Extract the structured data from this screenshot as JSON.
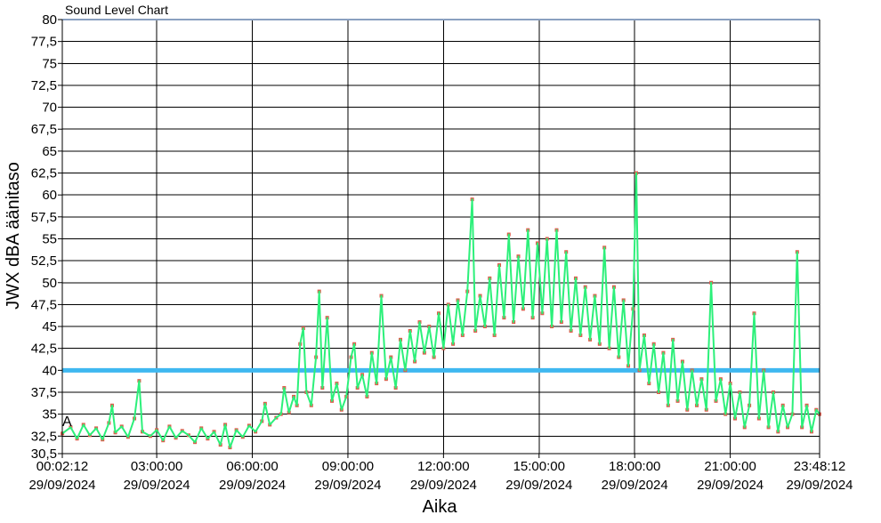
{
  "chart_data": {
    "type": "line",
    "title": "Sound Level Chart",
    "xlabel": "Aika",
    "ylabel": "JWX dBA äänitaso",
    "ylim": [
      30.5,
      80
    ],
    "xlim": [
      "00:02:12",
      "23:48:12"
    ],
    "grid": true,
    "yticks": [
      "30,5",
      "32,5",
      "35",
      "37,5",
      "40",
      "42,5",
      "45",
      "47,5",
      "50",
      "52,5",
      "55",
      "57,5",
      "60",
      "62,5",
      "65",
      "67,5",
      "70",
      "72,5",
      "75",
      "77,5",
      "80"
    ],
    "ytick_values": [
      30.5,
      32.5,
      35,
      37.5,
      40,
      42.5,
      45,
      47.5,
      50,
      52.5,
      55,
      57.5,
      60,
      62.5,
      65,
      67.5,
      70,
      72.5,
      75,
      77.5,
      80
    ],
    "xticks": [
      {
        "time": "00:02:12",
        "date": "29/09/2024",
        "hour": 0.0367
      },
      {
        "time": "03:00:00",
        "date": "29/09/2024",
        "hour": 3
      },
      {
        "time": "06:00:00",
        "date": "29/09/2024",
        "hour": 6
      },
      {
        "time": "09:00:00",
        "date": "29/09/2024",
        "hour": 9
      },
      {
        "time": "12:00:00",
        "date": "29/09/2024",
        "hour": 12
      },
      {
        "time": "15:00:00",
        "date": "29/09/2024",
        "hour": 15
      },
      {
        "time": "18:00:00",
        "date": "29/09/2024",
        "hour": 18
      },
      {
        "time": "21:00:00",
        "date": "29/09/2024",
        "hour": 21
      },
      {
        "time": "23:48:12",
        "date": "29/09/2024",
        "hour": 23.8033
      }
    ],
    "threshold": {
      "value": 40,
      "color": "#3FB8F0"
    },
    "marker_label": "A",
    "series": [
      {
        "color": "#2CF07A",
        "marker_color": "#E05A4A",
        "points": [
          [
            0.04,
            32.8
          ],
          [
            0.3,
            33.5
          ],
          [
            0.5,
            32.2
          ],
          [
            0.7,
            33.8
          ],
          [
            0.9,
            32.6
          ],
          [
            1.1,
            33.4
          ],
          [
            1.3,
            32.1
          ],
          [
            1.5,
            34.0
          ],
          [
            1.6,
            36.0
          ],
          [
            1.7,
            32.9
          ],
          [
            1.9,
            33.6
          ],
          [
            2.1,
            32.4
          ],
          [
            2.3,
            34.5
          ],
          [
            2.45,
            38.8
          ],
          [
            2.55,
            33.0
          ],
          [
            2.8,
            32.5
          ],
          [
            3.0,
            33.2
          ],
          [
            3.2,
            32.0
          ],
          [
            3.4,
            33.6
          ],
          [
            3.6,
            32.3
          ],
          [
            3.8,
            33.1
          ],
          [
            4.0,
            32.6
          ],
          [
            4.2,
            31.8
          ],
          [
            4.4,
            33.4
          ],
          [
            4.6,
            32.2
          ],
          [
            4.8,
            33.0
          ],
          [
            5.0,
            31.5
          ],
          [
            5.15,
            33.8
          ],
          [
            5.3,
            31.2
          ],
          [
            5.5,
            33.2
          ],
          [
            5.7,
            32.4
          ],
          [
            5.9,
            33.7
          ],
          [
            6.1,
            33.0
          ],
          [
            6.3,
            34.2
          ],
          [
            6.4,
            36.2
          ],
          [
            6.55,
            33.8
          ],
          [
            6.75,
            34.6
          ],
          [
            6.9,
            35.0
          ],
          [
            7.0,
            38.0
          ],
          [
            7.15,
            35.2
          ],
          [
            7.3,
            37.0
          ],
          [
            7.4,
            36.0
          ],
          [
            7.5,
            43.0
          ],
          [
            7.6,
            44.8
          ],
          [
            7.7,
            37.5
          ],
          [
            7.85,
            36.0
          ],
          [
            8.0,
            41.5
          ],
          [
            8.1,
            49.0
          ],
          [
            8.2,
            38.0
          ],
          [
            8.35,
            46.0
          ],
          [
            8.5,
            36.5
          ],
          [
            8.65,
            38.5
          ],
          [
            8.8,
            35.5
          ],
          [
            8.95,
            37.0
          ],
          [
            9.1,
            41.5
          ],
          [
            9.2,
            43.0
          ],
          [
            9.3,
            38.0
          ],
          [
            9.45,
            39.5
          ],
          [
            9.6,
            37.0
          ],
          [
            9.75,
            42.0
          ],
          [
            9.9,
            38.5
          ],
          [
            10.05,
            48.5
          ],
          [
            10.2,
            39.0
          ],
          [
            10.35,
            41.5
          ],
          [
            10.5,
            38.0
          ],
          [
            10.65,
            43.5
          ],
          [
            10.8,
            40.0
          ],
          [
            10.95,
            44.5
          ],
          [
            11.1,
            41.0
          ],
          [
            11.25,
            45.5
          ],
          [
            11.4,
            42.0
          ],
          [
            11.55,
            45.0
          ],
          [
            11.7,
            41.5
          ],
          [
            11.85,
            46.5
          ],
          [
            12.0,
            42.5
          ],
          [
            12.15,
            47.5
          ],
          [
            12.3,
            43.0
          ],
          [
            12.45,
            48.0
          ],
          [
            12.6,
            44.0
          ],
          [
            12.75,
            49.0
          ],
          [
            12.9,
            59.5
          ],
          [
            13.0,
            44.5
          ],
          [
            13.15,
            48.5
          ],
          [
            13.3,
            45.0
          ],
          [
            13.45,
            50.5
          ],
          [
            13.6,
            44.0
          ],
          [
            13.75,
            52.0
          ],
          [
            13.9,
            46.0
          ],
          [
            14.05,
            55.5
          ],
          [
            14.2,
            45.5
          ],
          [
            14.35,
            53.0
          ],
          [
            14.5,
            47.0
          ],
          [
            14.65,
            56.0
          ],
          [
            14.8,
            46.0
          ],
          [
            14.95,
            54.5
          ],
          [
            15.1,
            46.5
          ],
          [
            15.25,
            55.0
          ],
          [
            15.4,
            45.0
          ],
          [
            15.55,
            56.0
          ],
          [
            15.7,
            45.5
          ],
          [
            15.85,
            53.5
          ],
          [
            16.0,
            44.5
          ],
          [
            16.15,
            50.5
          ],
          [
            16.3,
            44.0
          ],
          [
            16.45,
            49.5
          ],
          [
            16.6,
            43.5
          ],
          [
            16.75,
            48.5
          ],
          [
            16.9,
            43.0
          ],
          [
            17.05,
            54.0
          ],
          [
            17.2,
            42.5
          ],
          [
            17.35,
            49.5
          ],
          [
            17.5,
            41.5
          ],
          [
            17.65,
            48.0
          ],
          [
            17.8,
            40.5
          ],
          [
            17.95,
            47.0
          ],
          [
            18.05,
            62.5
          ],
          [
            18.15,
            40.0
          ],
          [
            18.3,
            44.0
          ],
          [
            18.45,
            38.5
          ],
          [
            18.6,
            43.0
          ],
          [
            18.75,
            37.5
          ],
          [
            18.9,
            42.0
          ],
          [
            19.05,
            36.0
          ],
          [
            19.2,
            43.5
          ],
          [
            19.35,
            36.5
          ],
          [
            19.5,
            41.0
          ],
          [
            19.65,
            35.5
          ],
          [
            19.8,
            40.0
          ],
          [
            19.95,
            36.0
          ],
          [
            20.1,
            39.0
          ],
          [
            20.25,
            35.5
          ],
          [
            20.4,
            50.0
          ],
          [
            20.55,
            36.5
          ],
          [
            20.7,
            39.0
          ],
          [
            20.85,
            35.0
          ],
          [
            21.0,
            38.5
          ],
          [
            21.15,
            34.5
          ],
          [
            21.3,
            37.5
          ],
          [
            21.45,
            33.5
          ],
          [
            21.6,
            36.0
          ],
          [
            21.75,
            46.5
          ],
          [
            21.9,
            34.5
          ],
          [
            22.05,
            40.0
          ],
          [
            22.2,
            33.5
          ],
          [
            22.35,
            37.5
          ],
          [
            22.5,
            33.0
          ],
          [
            22.65,
            36.0
          ],
          [
            22.8,
            33.5
          ],
          [
            22.95,
            35.0
          ],
          [
            23.1,
            53.5
          ],
          [
            23.25,
            33.5
          ],
          [
            23.4,
            36.0
          ],
          [
            23.55,
            33.0
          ],
          [
            23.7,
            35.5
          ],
          [
            23.8,
            35.0
          ]
        ]
      }
    ]
  }
}
